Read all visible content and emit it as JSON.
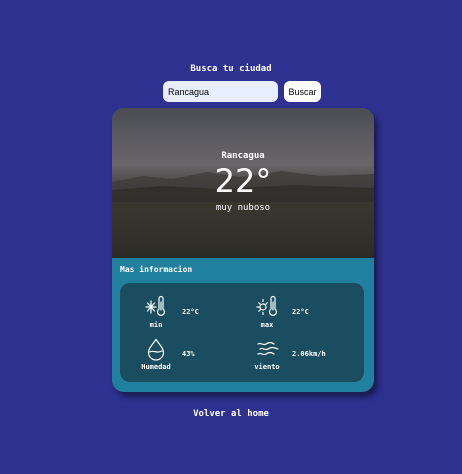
{
  "search": {
    "title": "Busca tu ciudad",
    "input_value": "Rancagua",
    "button_label": "Buscar"
  },
  "weather": {
    "city": "Rancagua",
    "temperature": "22°",
    "condition": "muy nuboso"
  },
  "details": {
    "title": "Mas informacion",
    "stats": [
      {
        "icon": "snow-thermometer-icon",
        "label": "min",
        "value": "22°C"
      },
      {
        "icon": "sun-thermometer-icon",
        "label": "max",
        "value": "22°C"
      },
      {
        "icon": "water-drop-icon",
        "label": "Humedad",
        "value": "43%"
      },
      {
        "icon": "wind-icon",
        "label": "viento",
        "value": "2.06km/h"
      }
    ]
  },
  "footer": {
    "home_link": "Volver al home"
  },
  "colors": {
    "background": "#2e3190",
    "card": "#22809f",
    "inner": "#1b4d60"
  }
}
